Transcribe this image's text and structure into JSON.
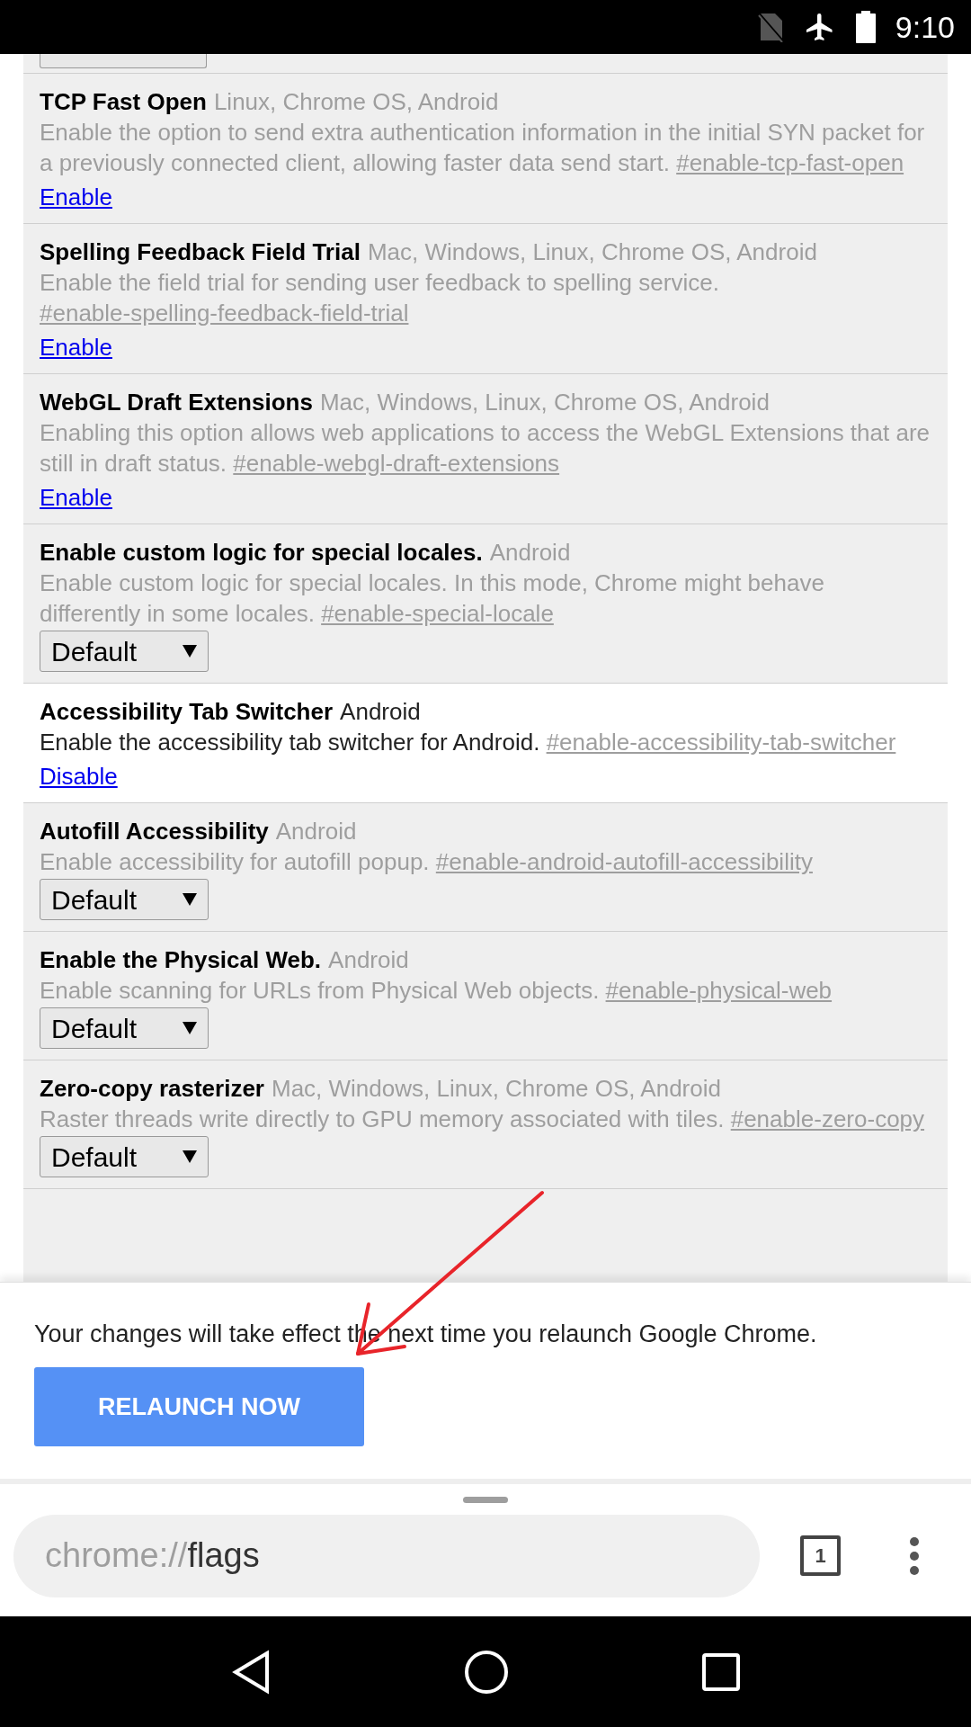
{
  "status_bar": {
    "time": "9:10"
  },
  "flags": [
    {
      "title": "TCP Fast Open",
      "platforms": "Linux, Chrome OS, Android",
      "description": "Enable the option to send extra authentication information in the initial SYN packet for a previously connected client, allowing faster data send start.",
      "anchor": "#enable-tcp-fast-open",
      "enabled": false,
      "control": {
        "kind": "link",
        "label": "Enable"
      }
    },
    {
      "title": "Spelling Feedback Field Trial",
      "platforms": "Mac, Windows, Linux, Chrome OS, Android",
      "description": "Enable the field trial for sending user feedback to spelling service.",
      "anchor": "#enable-spelling-feedback-field-trial",
      "enabled": false,
      "control": {
        "kind": "link",
        "label": "Enable"
      }
    },
    {
      "title": "WebGL Draft Extensions",
      "platforms": "Mac, Windows, Linux, Chrome OS, Android",
      "description": "Enabling this option allows web applications to access the WebGL Extensions that are still in draft status.",
      "anchor": "#enable-webgl-draft-extensions",
      "enabled": false,
      "control": {
        "kind": "link",
        "label": "Enable"
      }
    },
    {
      "title": "Enable custom logic for special locales.",
      "platforms": "Android",
      "description": "Enable custom logic for special locales. In this mode, Chrome might behave differently in some locales.",
      "anchor": "#enable-special-locale",
      "enabled": false,
      "control": {
        "kind": "select",
        "label": "Default"
      }
    },
    {
      "title": "Accessibility Tab Switcher",
      "platforms": "Android",
      "description": "Enable the accessibility tab switcher for Android.",
      "anchor": "#enable-accessibility-tab-switcher",
      "enabled": true,
      "control": {
        "kind": "link",
        "label": "Disable"
      }
    },
    {
      "title": "Autofill Accessibility",
      "platforms": "Android",
      "description": "Enable accessibility for autofill popup.",
      "anchor": "#enable-android-autofill-accessibility",
      "enabled": false,
      "control": {
        "kind": "select",
        "label": "Default"
      }
    },
    {
      "title": "Enable the Physical Web.",
      "platforms": "Android",
      "description": "Enable scanning for URLs from Physical Web objects.",
      "anchor": "#enable-physical-web",
      "enabled": false,
      "control": {
        "kind": "select",
        "label": "Default"
      }
    },
    {
      "title": "Zero-copy rasterizer",
      "platforms": "Mac, Windows, Linux, Chrome OS, Android",
      "description": "Raster threads write directly to GPU memory associated with tiles.",
      "anchor": "#enable-zero-copy",
      "enabled": false,
      "control": {
        "kind": "select",
        "label": "Default"
      }
    }
  ],
  "infobar": {
    "message": "Your changes will take effect the next time you relaunch Google Chrome.",
    "button": "RELAUNCH NOW"
  },
  "toolbar": {
    "url_scheme": "chrome://",
    "url_path": "flags",
    "tab_count": "1"
  }
}
